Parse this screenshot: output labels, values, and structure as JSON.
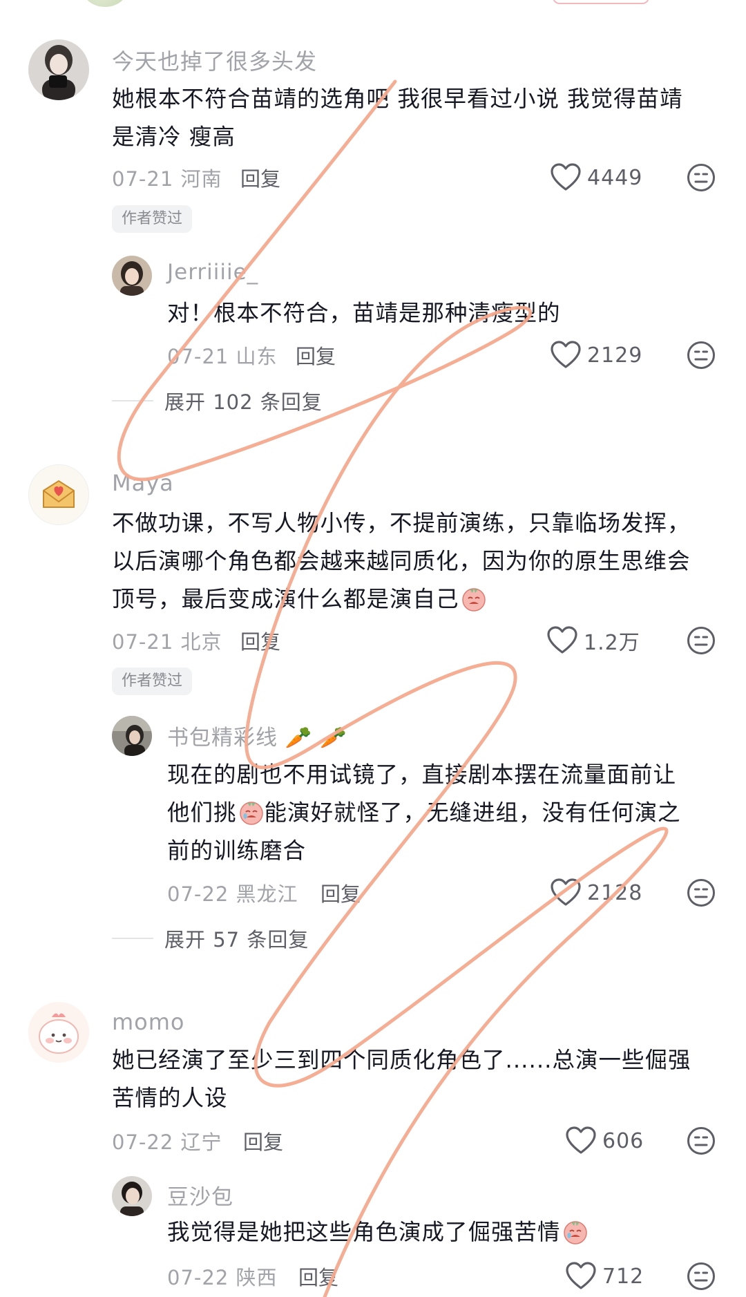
{
  "comments": [
    {
      "username": "今天也掉了很多头发",
      "text_lines": [
        "她根本不符合苗靖的选角吧 我很早看过小说 我觉得苗靖",
        "是清冷 瘦高"
      ],
      "date": "07-21",
      "location": "河南",
      "reply_label": "回复",
      "likes": "4449",
      "badge": "作者赞过",
      "reply": {
        "username": "Jerriiiie_",
        "text_lines": [
          "对！根本不符合，苗靖是那种清瘦型的"
        ],
        "date": "07-21",
        "location": "山东",
        "reply_label": "回复",
        "likes": "2129"
      },
      "expand_label": "展开 102 条回复"
    },
    {
      "username": "Maya",
      "text_lines": [
        "不做功课，不写人物小传，不提前演练，只靠临场发挥，",
        "以后演哪个角色都会越来越同质化，因为你的原生思维会",
        "顶号，最后变成演什么都是演自己"
      ],
      "date": "07-21",
      "location": "北京",
      "reply_label": "回复",
      "likes": "1.2万",
      "badge": "作者赞过",
      "reply": {
        "username": "书包精彩线",
        "username_emoji": "🥕 🥕",
        "text_lines": [
          "现在的剧也不用试镜了，直接剧本摆在流量面前让",
          "他们挑",
          "能演好就怪了，无缝进组，没有任何演之",
          "前的训练磨合"
        ],
        "date": "07-22",
        "location": "黑龙江",
        "reply_label": "回复",
        "likes": "2128"
      },
      "expand_label": "展开 57 条回复"
    },
    {
      "username": "momo",
      "text_lines": [
        "她已经演了至少三到四个同质化角色了......总演一些倔强",
        "苦情的人设"
      ],
      "date": "07-22",
      "location": "辽宁",
      "reply_label": "回复",
      "likes": "606",
      "reply": {
        "username": "豆沙包",
        "text_lines": [
          "我觉得是她把这些角色演成了倔强苦情"
        ],
        "date": "07-22",
        "location": "陕西",
        "reply_label": "回复",
        "likes": "712"
      }
    }
  ],
  "colors": {
    "scribble": "#f4a98e",
    "text_primary": "#161823",
    "text_secondary": "#a2a3a8"
  },
  "icons": [
    "heart-icon",
    "dislike-face-icon",
    "crying-face-emoji",
    "envelope-heart-icon",
    "carrot-emoji"
  ]
}
